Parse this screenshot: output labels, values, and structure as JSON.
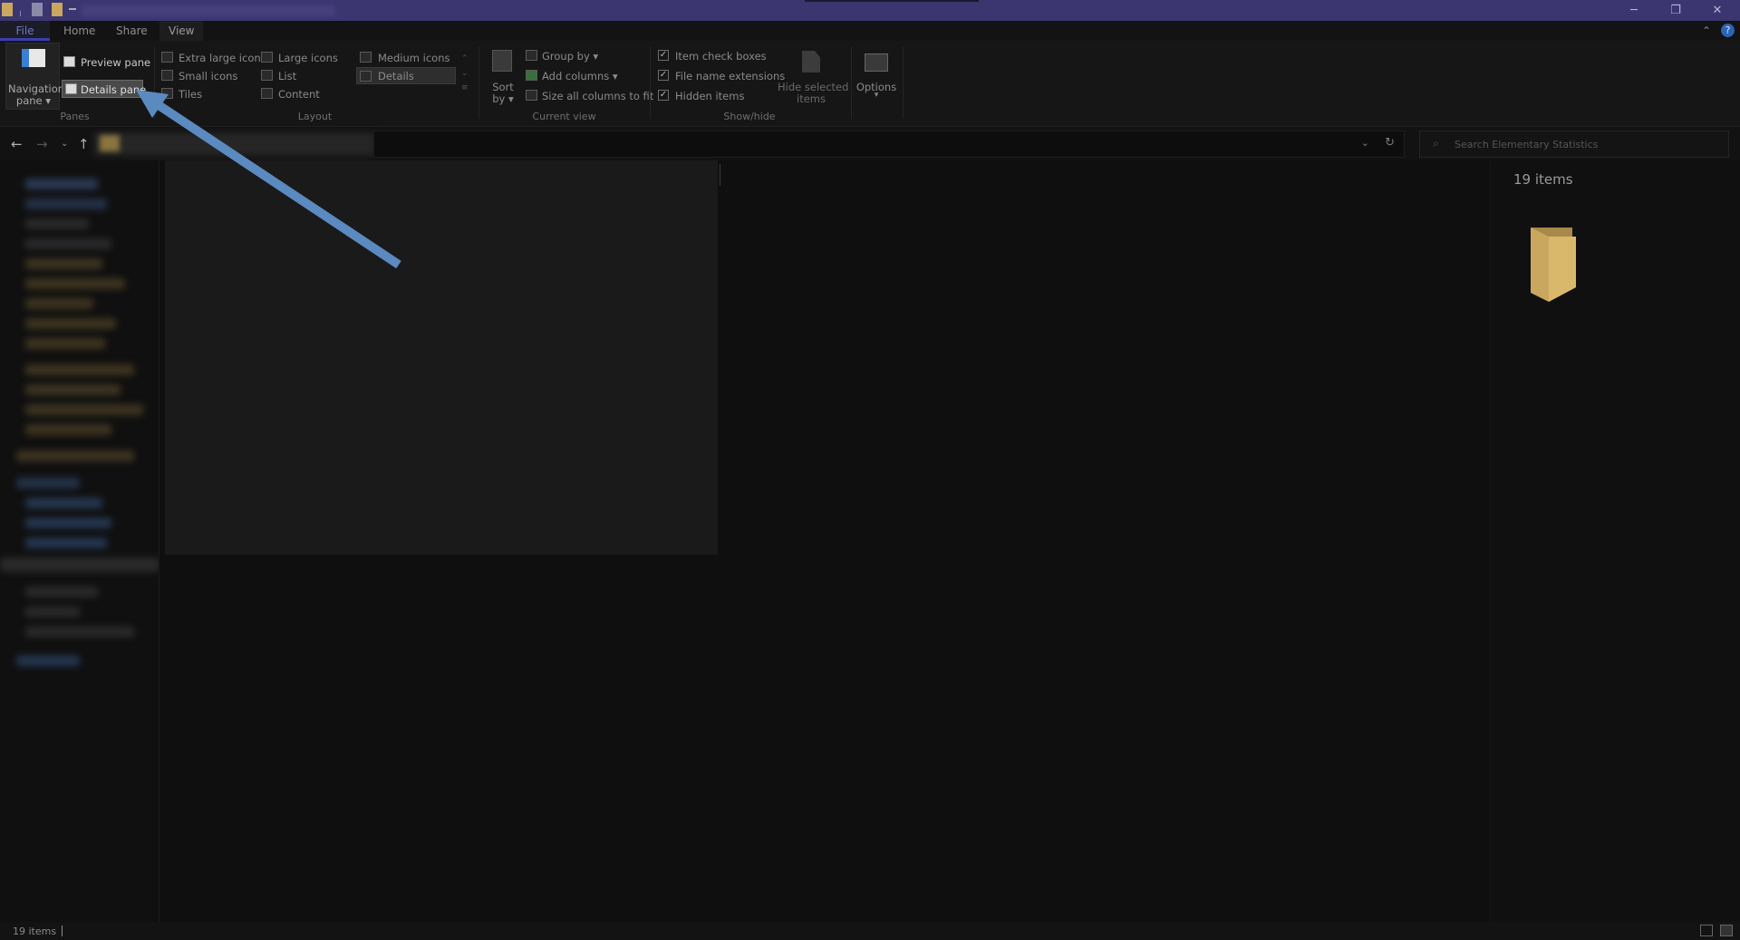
{
  "ribbon_tabs": {
    "file": "File",
    "home": "Home",
    "share": "Share",
    "view": "View"
  },
  "panes": {
    "navigation_pane_line1": "Navigation",
    "navigation_pane_line2": "pane",
    "preview_pane": "Preview pane",
    "details_pane": "Details pane",
    "group_label": "Panes"
  },
  "layout": {
    "extra_large_icons": "Extra large icons",
    "large_icons": "Large icons",
    "medium_icons": "Medium icons",
    "small_icons": "Small icons",
    "list": "List",
    "details": "Details",
    "tiles": "Tiles",
    "content": "Content",
    "group_label": "Layout"
  },
  "current_view": {
    "sort_by_line1": "Sort",
    "sort_by_line2": "by",
    "group_by": "Group by",
    "add_columns": "Add columns",
    "size_all_columns": "Size all columns to fit",
    "group_label": "Current view"
  },
  "show_hide": {
    "item_check_boxes": "Item check boxes",
    "file_name_extensions": "File name extensions",
    "hidden_items": "Hidden items",
    "hide_selected_line1": "Hide selected",
    "hide_selected_line2": "items",
    "group_label": "Show/hide"
  },
  "options": {
    "label": "Options"
  },
  "search": {
    "placeholder": "Search Elementary Statistics"
  },
  "details_pane": {
    "item_count": "19 items"
  },
  "status_bar": {
    "item_count": "19 items"
  },
  "colors": {
    "titlebar": "#3b3570",
    "accent": "#3a3fb3",
    "folder": "#c9a75e",
    "arrow": "#5b8ac0"
  }
}
